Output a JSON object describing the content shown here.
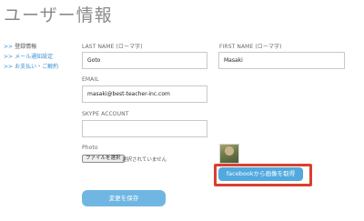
{
  "page": {
    "title": "ユーザー情報"
  },
  "sidebar": {
    "items": [
      {
        "arrow": ">>",
        "label": "登録情報"
      },
      {
        "arrow": ">>",
        "label": "メール通知設定"
      },
      {
        "arrow": ">>",
        "label": "お支払い・ご解約"
      }
    ]
  },
  "form": {
    "last_name": {
      "label": "LAST NAME (ローマ字)",
      "value": "Goto"
    },
    "first_name": {
      "label": "FIRST NAME (ローマ字)",
      "value": "Masaki"
    },
    "email": {
      "label": "EMAIL",
      "value": "masaki@best-teacher-inc.com"
    },
    "skype": {
      "label": "SKYPE ACCOUNT",
      "value": ""
    },
    "photo": {
      "label": "Photo",
      "choose_file_label": "ファイルを選択",
      "no_file_text": "選択されていません",
      "facebook_button_label": "facebookから画像を取得"
    },
    "save_button_label": "変更を保存"
  },
  "colors": {
    "accent": "#52a9de",
    "save_button": "#6fb7e2",
    "highlight": "#d9402f",
    "link": "#3a8fd0"
  }
}
